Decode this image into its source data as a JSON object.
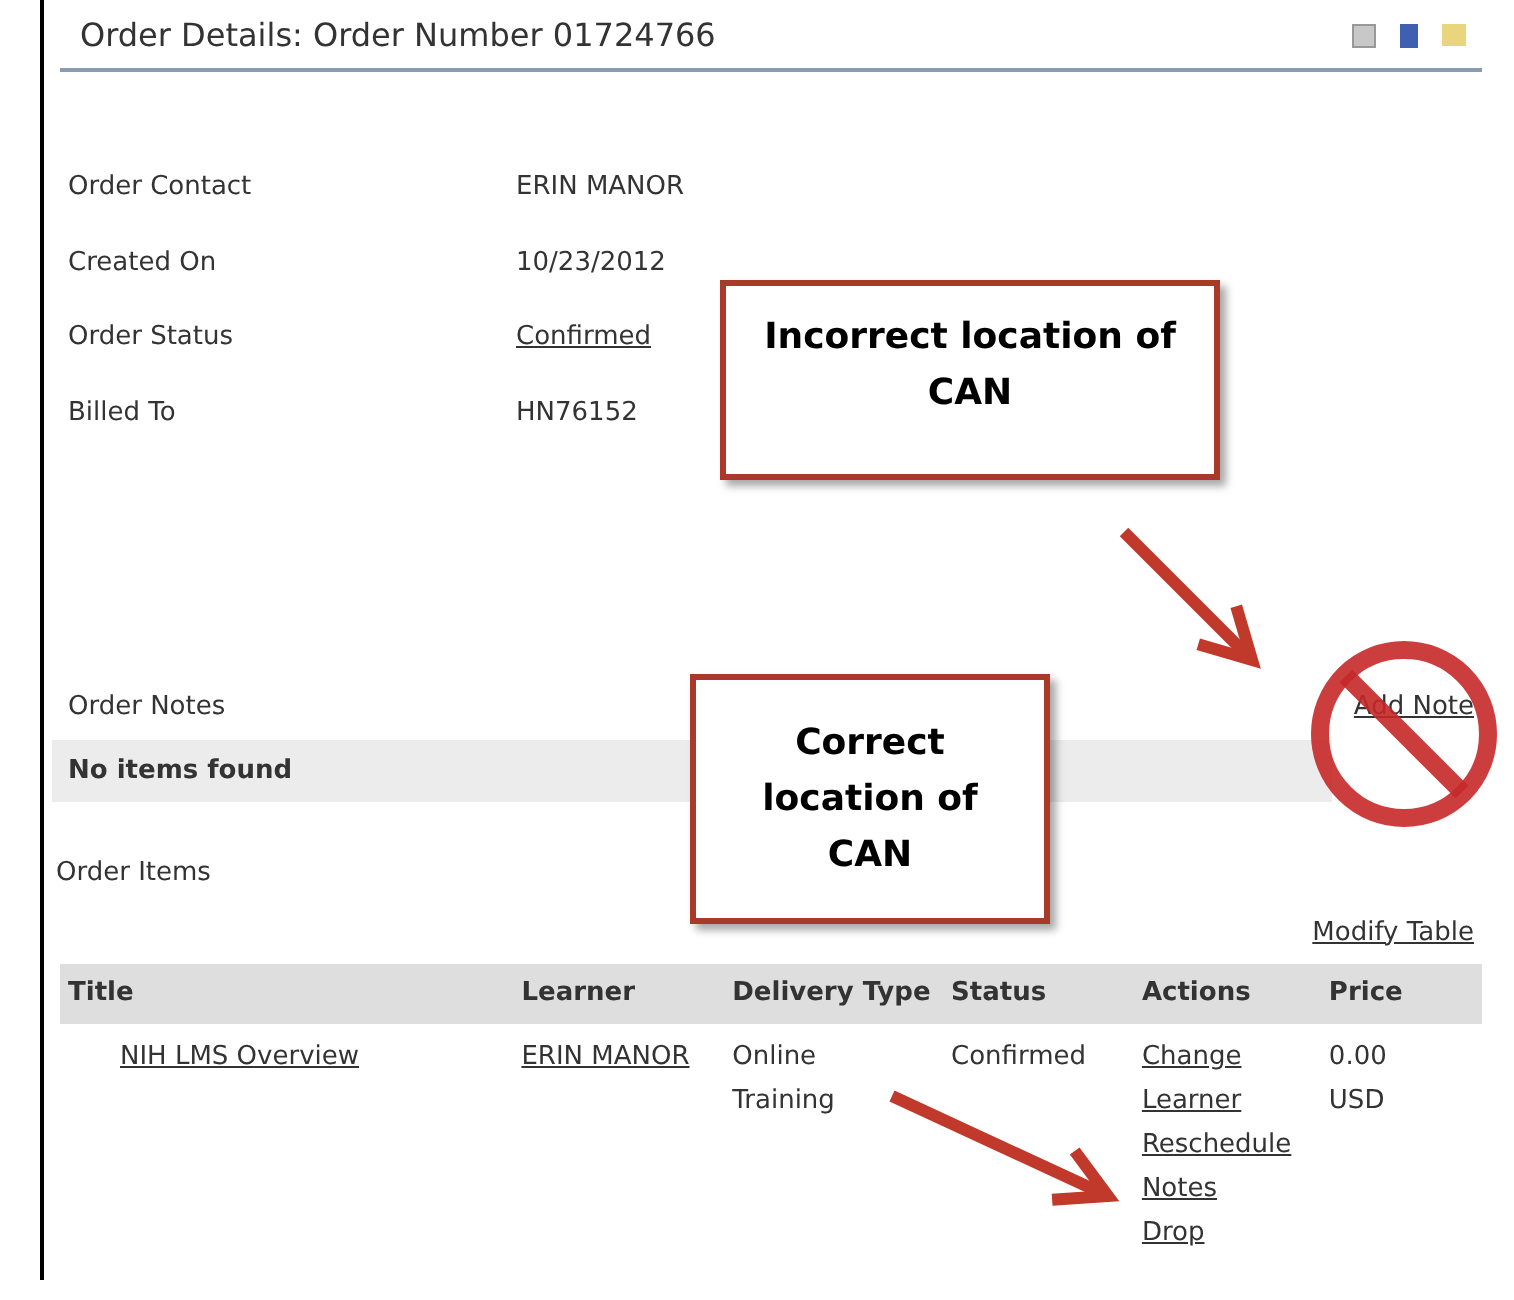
{
  "header": {
    "title": "Order Details: Order Number 01724766"
  },
  "details": [
    {
      "label": "Order Contact",
      "value": "ERIN MANOR",
      "kind": "text"
    },
    {
      "label": "Created On",
      "value": "10/23/2012",
      "kind": "text"
    },
    {
      "label": "Order Status",
      "value": "Confirmed",
      "kind": "link"
    },
    {
      "label": "Billed To",
      "value": "HN76152",
      "kind": "text"
    }
  ],
  "order_notes": {
    "title": "Order Notes",
    "add_link": "Add Note",
    "empty": "No items found"
  },
  "order_items": {
    "title": "Order Items",
    "modify_link": "Modify Table",
    "columns": [
      "Title",
      "Learner",
      "Delivery Type",
      "Status",
      "Actions",
      "Price"
    ],
    "rows": [
      {
        "title": "NIH LMS Overview",
        "learner": "ERIN MANOR",
        "delivery_type": "Online Training",
        "status": "Confirmed",
        "actions": [
          "Change Learner",
          "Reschedule",
          "Notes",
          "Drop"
        ],
        "price": "0.00 USD"
      }
    ]
  },
  "annotations": [
    {
      "kind": "callout",
      "text": "Incorrect location of CAN"
    },
    {
      "kind": "callout",
      "text": "Correct location of CAN"
    }
  ]
}
